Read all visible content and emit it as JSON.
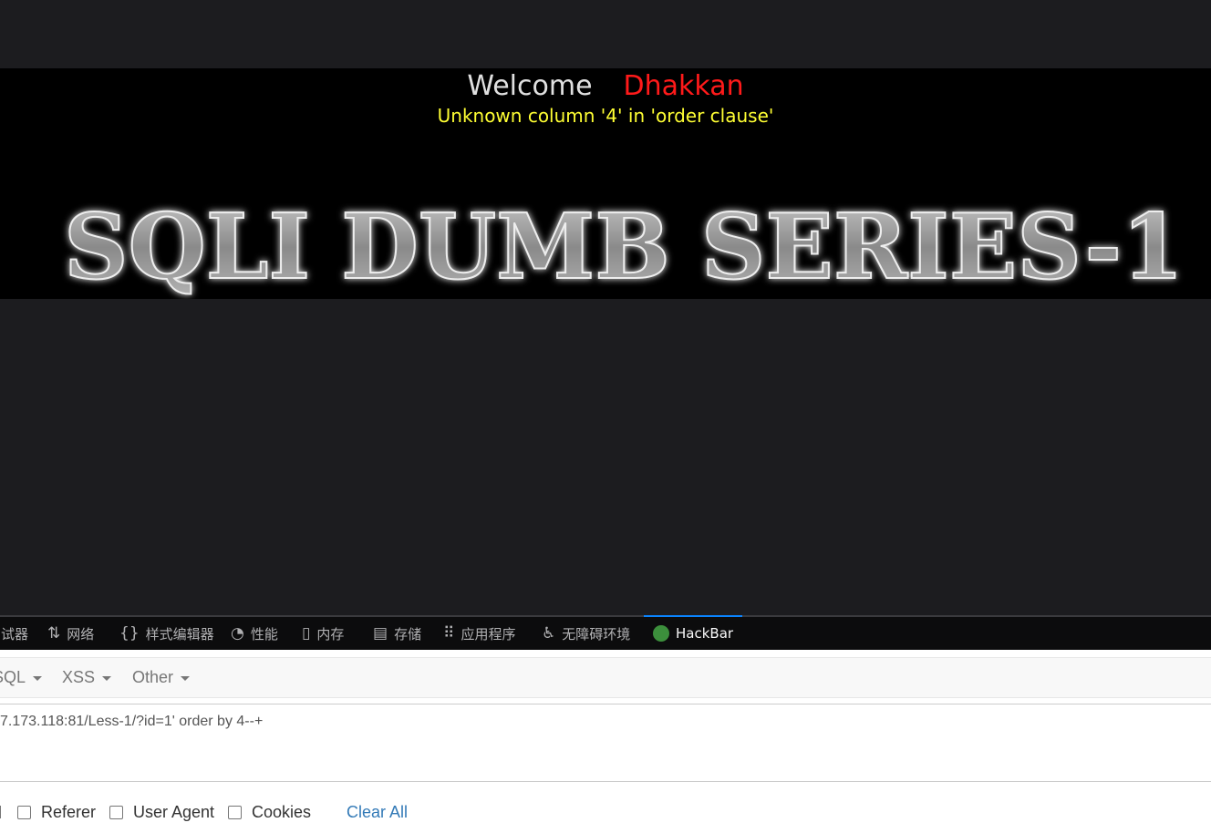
{
  "page": {
    "welcome_label": "Welcome",
    "welcome_name": "Dhakkan",
    "error_message": "Unknown column '4' in 'order clause'",
    "logo_text": "SQLI DUMB SERIES-1"
  },
  "devtools": {
    "tabs": [
      {
        "label": "调试器",
        "icon": "debugger-icon"
      },
      {
        "label": "网络",
        "icon": "network-icon"
      },
      {
        "label": "样式编辑器",
        "icon": "style-editor-icon"
      },
      {
        "label": "性能",
        "icon": "performance-icon"
      },
      {
        "label": "内存",
        "icon": "memory-icon"
      },
      {
        "label": "存储",
        "icon": "storage-icon"
      },
      {
        "label": "应用程序",
        "icon": "application-icon"
      },
      {
        "label": "无障碍环境",
        "icon": "accessibility-icon"
      },
      {
        "label": "HackBar",
        "icon": "hackbar-icon",
        "active": true
      }
    ]
  },
  "hackbar": {
    "menus": [
      {
        "label": "SQL"
      },
      {
        "label": "XSS"
      },
      {
        "label": "Other"
      }
    ],
    "url_value": "7.173.118:81/Less-1/?id=1' order by 4--+",
    "options": [
      {
        "label": "Referer",
        "checked": false
      },
      {
        "label": "User Agent",
        "checked": false
      },
      {
        "label": "Cookies",
        "checked": false
      }
    ],
    "clear_all_label": "Clear All"
  },
  "colors": {
    "banner_bg": "#000000",
    "welcome_name": "#ff1a1a",
    "error_text": "#ffff33",
    "active_tab_accent": "#0a84ff",
    "link": "#337ab7"
  }
}
